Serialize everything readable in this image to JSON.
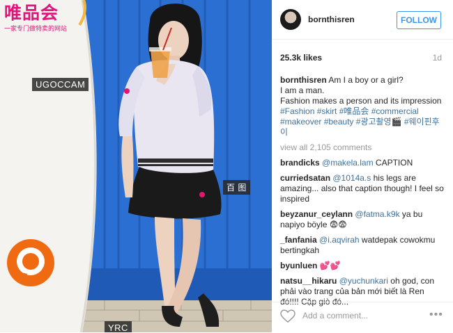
{
  "photo": {
    "brand_name": "唯品会",
    "brand_tagline": "一家专门做特卖的网站",
    "tags": [
      "UGOCCAM",
      "百 图",
      "YRC"
    ]
  },
  "header": {
    "username": "bornthisren",
    "follow_label": "FOLLOW"
  },
  "meta": {
    "likes": "25.3k likes",
    "time": "1d"
  },
  "caption": {
    "username": "bornthisren",
    "line1": "Am I a boy or a girl?",
    "line2": "I am a man.",
    "line3": "Fashion makes a person and its impression",
    "hashtags": "#Fashion #skirt #唯品会 #commercial #makeover #beauty #광고촬영🎬 #웨이핀후이"
  },
  "view_all": "view all 2,105 comments",
  "comments": [
    {
      "user": "brandicks",
      "mention": "@makela.lam",
      "text": " CAPTION"
    },
    {
      "user": "curriedsatan",
      "mention": "@1014a.s",
      "text": " his legs are amazing... also that caption though! I feel so inspired"
    },
    {
      "user": "beyzanur_ceylann",
      "mention": "@fatma.k9k",
      "text": " ya bu napiyo böyle 😨😨"
    },
    {
      "user": "_fanfania",
      "mention": "@i.aqvirah",
      "text": " watdepak cowokmu bertingkah"
    },
    {
      "user": "byunluen",
      "mention": "",
      "text": " 💕💕"
    },
    {
      "user": "natsu__hikaru",
      "mention": "@yuchunkari",
      "text": " oh god, con phải vào trang của bản mới biết là Ren đó!!!! Cặp giò đó..."
    }
  ],
  "footer": {
    "add_comment_placeholder": "Add a comment...",
    "more_label": "•••"
  },
  "colors": {
    "accent": "#3897f0",
    "link": "#3f729b",
    "brand_pink": "#e0147a",
    "container_blue": "#2b6fd0"
  }
}
